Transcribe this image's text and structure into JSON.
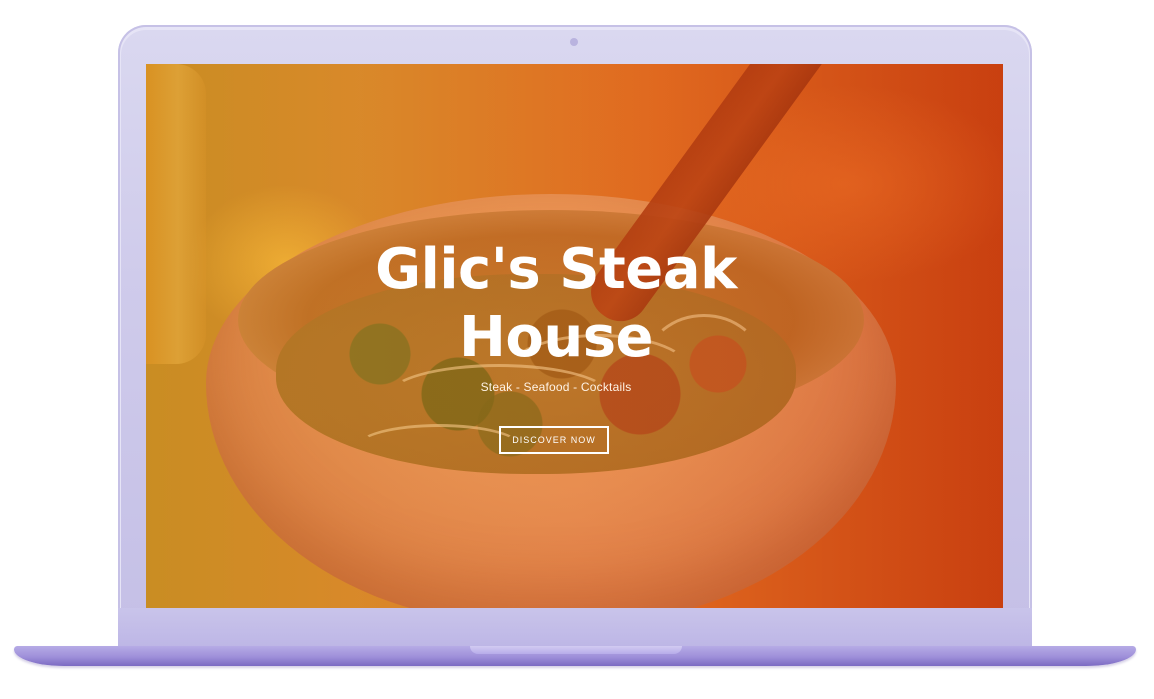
{
  "hero": {
    "title_line1": "Glic's Steak",
    "title_line2": "House",
    "subtitle": "Steak - Seafood - Cocktails",
    "cta_label": "DISCOVER NOW"
  },
  "colors": {
    "device_frame": "#cfcbeb",
    "device_base": "#9e8fd9",
    "overlay_left": "#c68a21",
    "overlay_right": "#c9410f",
    "text": "#ffffff"
  }
}
